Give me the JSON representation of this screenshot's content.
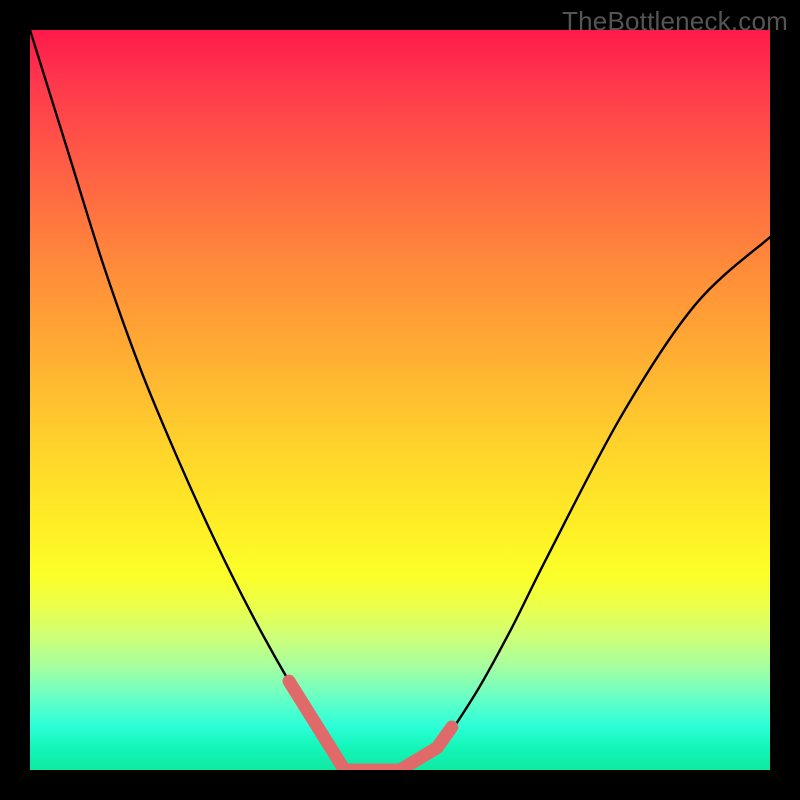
{
  "watermark": "TheBottleneck.com",
  "chart_data": {
    "type": "line",
    "title": "",
    "xlabel": "",
    "ylabel": "",
    "xlim": [
      0,
      1
    ],
    "ylim": [
      0,
      1
    ],
    "series": [
      {
        "name": "curve",
        "x": [
          0.0,
          0.05,
          0.1,
          0.15,
          0.2,
          0.25,
          0.3,
          0.35,
          0.4,
          0.425,
          0.45,
          0.5,
          0.55,
          0.6,
          0.65,
          0.7,
          0.8,
          0.9,
          1.0
        ],
        "y": [
          1.0,
          0.84,
          0.68,
          0.54,
          0.42,
          0.31,
          0.21,
          0.12,
          0.04,
          0.0,
          0.0,
          0.0,
          0.03,
          0.1,
          0.19,
          0.29,
          0.48,
          0.63,
          0.72
        ],
        "color": "#000000"
      }
    ],
    "accent_segments": [
      {
        "name": "left-accent",
        "from_x": 0.35,
        "to_x": 0.425,
        "color": "#e06a6a",
        "width": 13
      },
      {
        "name": "valley-accent",
        "from_x": 0.425,
        "to_x": 0.5,
        "color": "#e06a6a",
        "width": 13
      },
      {
        "name": "right-accent",
        "from_x": 0.5,
        "to_x": 0.57,
        "color": "#e06a6a",
        "width": 13
      }
    ],
    "background_gradient": {
      "top": "#ff1a4b",
      "mid": "#fff125",
      "bottom": "#0fe9a2"
    }
  }
}
